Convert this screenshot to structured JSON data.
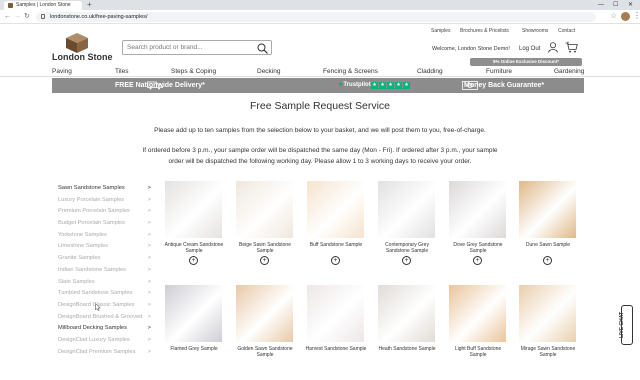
{
  "browser": {
    "tab_title": "Samples | London Stone",
    "new_tab": "+",
    "url": "londonstone.co.uk/free-paving-samples/",
    "controls": {
      "min": "—",
      "max": "☐",
      "close": "✕"
    }
  },
  "header": {
    "logo_text": "London Stone",
    "search_placeholder": "Search product or brand...",
    "top_links": [
      "Samples",
      "Brochures & Pricelists",
      "Showrooms",
      "Contact"
    ],
    "welcome": "Welcome, London Stone Demo!",
    "logout": "Log Out",
    "cart_count": "0",
    "showroom_banner": "5% Online Exclusive Discount*"
  },
  "nav": [
    "Paving",
    "Tiles",
    "Steps & Coping",
    "Decking",
    "Fencing & Screens",
    "Cladding",
    "Furniture",
    "Gardening"
  ],
  "banner": {
    "delivery": "FREE Nationwide Delivery*",
    "trustpilot": "Trustpilot",
    "money_back": "Money Back Guarantee*",
    "colors": {
      "bg": "#8c8c8c",
      "trustpilot_green": "#00b67a"
    }
  },
  "page": {
    "title": "Free Sample Request Service",
    "intro": "Please add up to ten samples from the selection below to your basket, and we will post them to you, free-of-charge.",
    "dispatch_line1": "If ordered before 3 p.m., your sample order will be dispatched the same day (Mon - Fri). If ordered after 3 p.m., your sample",
    "dispatch_line2": "order will be dispatched the following working day. Please allow 1 to 3 working days to receive your order."
  },
  "sidebar": [
    {
      "label": "Sawn Sandstone Samples",
      "active": true
    },
    {
      "label": "Luxury Porcelain Samples",
      "active": false
    },
    {
      "label": "Premium Porcelain Samples",
      "active": false
    },
    {
      "label": "Budget Porcelain Samples",
      "active": false
    },
    {
      "label": "Yorkstone Samples",
      "active": false
    },
    {
      "label": "Limestone Samples",
      "active": false
    },
    {
      "label": "Granite Samples",
      "active": false
    },
    {
      "label": "Indian Sandstone Samples",
      "active": false
    },
    {
      "label": "Slate Samples",
      "active": false
    },
    {
      "label": "Tumbled Sandstone Samples",
      "active": false
    },
    {
      "label": "DesignBoard Classic Samples",
      "active": false
    },
    {
      "label": "DesignBoard Brushed & Grooved",
      "active": false
    },
    {
      "label": "Millboard Decking Samples",
      "active": true
    },
    {
      "label": "DesignClad Luxury Samples",
      "active": false
    },
    {
      "label": "DesignClad Premium Samples",
      "active": false
    }
  ],
  "sidebar_chevron": ">",
  "products": [
    {
      "name": "Antique Cream Sandstone Sample",
      "color": "#e4e2e0"
    },
    {
      "name": "Beige Sawn Sandstone Sample",
      "color": "#efe7dc"
    },
    {
      "name": "Buff Sandstone Sample",
      "color": "#f6e3cc"
    },
    {
      "name": "Contemporary Grey Sandstone Sample",
      "color": "#e2e0e1"
    },
    {
      "name": "Dove Grey Sandstone Sample",
      "color": "#dcd8d8"
    },
    {
      "name": "Dune Sawn Sample",
      "color": "#dfb888"
    },
    {
      "name": "Flamed Grey Sample",
      "color": "#cdcdd4"
    },
    {
      "name": "Golden Sawn Sandstone Sample",
      "color": "#e8c9a7"
    },
    {
      "name": "Harvest Sandstone Sample",
      "color": "#ece7e6"
    },
    {
      "name": "Heath Sandstone Sample",
      "color": "#e0dcd6"
    },
    {
      "name": "Light Buff Sandstone Sample",
      "color": "#eac49b"
    },
    {
      "name": "Mirage Sawn Sandstone Sample",
      "color": "#e9cfae"
    }
  ],
  "add_symbol": "+",
  "live_chat": "LIVE CHAT"
}
